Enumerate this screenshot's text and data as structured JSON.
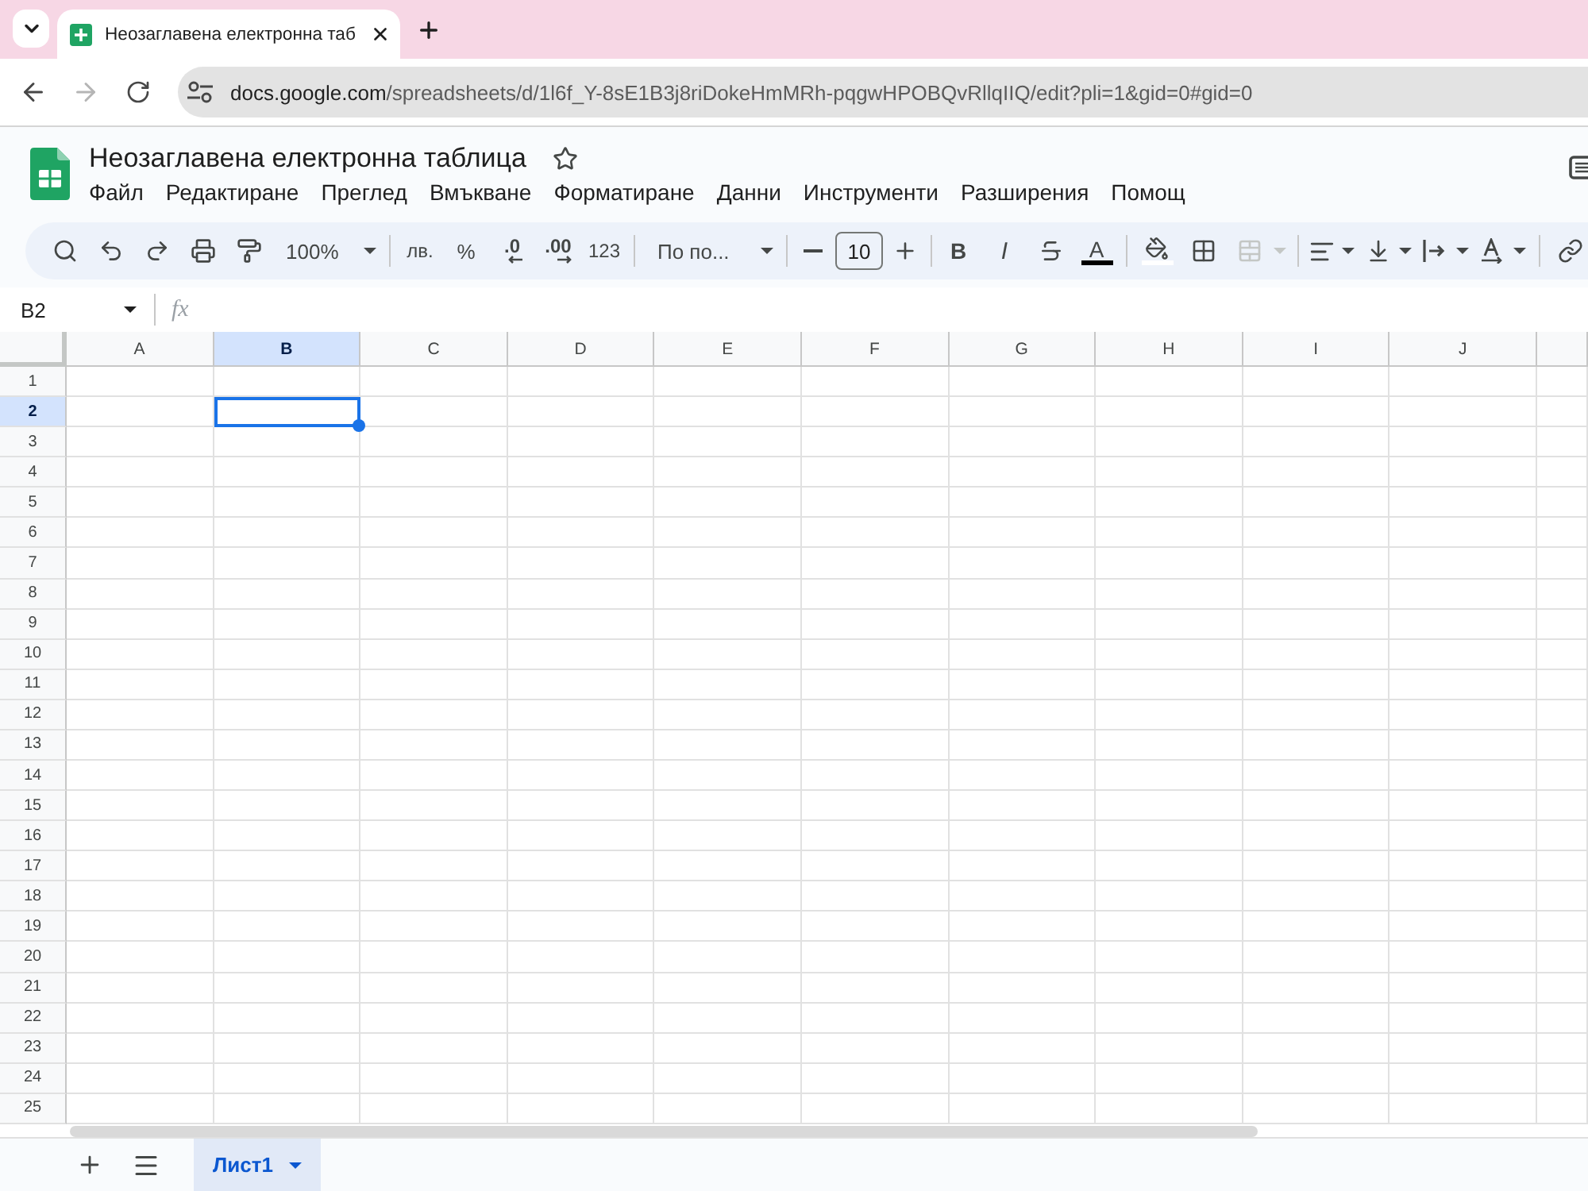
{
  "browser": {
    "tabs": [
      {
        "title": "Неозаглавена електронна таб",
        "selected": true
      }
    ],
    "nav": {
      "back_disabled": false,
      "forward_disabled": true
    },
    "address": {
      "host": "docs.google.com",
      "path": "/spreadsheets/d/1l6f_Y-8sE1B3j8riDokeHmMRh-pqgwHPOBQvRllqIIQ/edit?pli=1&gid=0#gid=0"
    }
  },
  "document": {
    "title": "Неозаглавена електронна таблица",
    "starred": false
  },
  "menu": [
    "Файл",
    "Редактиране",
    "Преглед",
    "Вмъкване",
    "Форматиране",
    "Данни",
    "Инструменти",
    "Разширения",
    "Помощ"
  ],
  "toolbar": {
    "zoom": "100%",
    "currency": "лв.",
    "percent": "%",
    "decimal_decrease": ".0",
    "decimal_increase": ".00",
    "number_format": "123",
    "font": "По по...",
    "font_size": "10",
    "bold": "B",
    "italic": "I",
    "text_color_label": "A",
    "merge_disabled": true
  },
  "formula_bar": {
    "name_box": "B2",
    "fx": "fx"
  },
  "grid": {
    "columns": [
      {
        "label": "A",
        "selected": false
      },
      {
        "label": "B",
        "selected": true
      },
      {
        "label": "C",
        "selected": false
      },
      {
        "label": "D",
        "selected": false
      },
      {
        "label": "E",
        "selected": false
      },
      {
        "label": "F",
        "selected": false
      },
      {
        "label": "G",
        "selected": false
      },
      {
        "label": "H",
        "selected": false
      },
      {
        "label": "I",
        "selected": false
      },
      {
        "label": "J",
        "selected": false
      }
    ],
    "rows": [
      {
        "label": "1",
        "selected": false
      },
      {
        "label": "2",
        "selected": true
      },
      {
        "label": "3",
        "selected": false
      },
      {
        "label": "4",
        "selected": false
      },
      {
        "label": "5",
        "selected": false
      },
      {
        "label": "6",
        "selected": false
      },
      {
        "label": "7",
        "selected": false
      },
      {
        "label": "8",
        "selected": false
      },
      {
        "label": "9",
        "selected": false
      },
      {
        "label": "10",
        "selected": false
      },
      {
        "label": "11",
        "selected": false
      },
      {
        "label": "12",
        "selected": false
      },
      {
        "label": "13",
        "selected": false
      },
      {
        "label": "14",
        "selected": false
      },
      {
        "label": "15",
        "selected": false
      },
      {
        "label": "16",
        "selected": false
      },
      {
        "label": "17",
        "selected": false
      },
      {
        "label": "18",
        "selected": false
      },
      {
        "label": "19",
        "selected": false
      },
      {
        "label": "20",
        "selected": false
      },
      {
        "label": "21",
        "selected": false
      },
      {
        "label": "22",
        "selected": false
      },
      {
        "label": "23",
        "selected": false
      },
      {
        "label": "24",
        "selected": false
      },
      {
        "label": "25",
        "selected": false
      }
    ]
  },
  "sheets": [
    {
      "name": "Лист1",
      "selected": true
    }
  ]
}
